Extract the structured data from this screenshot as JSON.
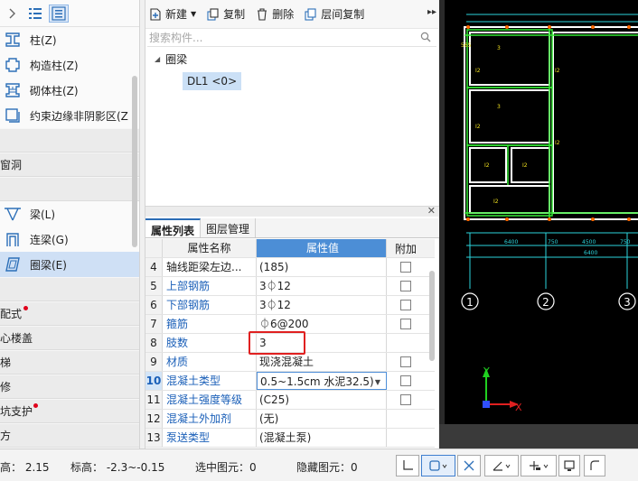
{
  "left_panel": {
    "items_top": [
      {
        "label": "柱(Z)",
        "icon": "column-icon"
      },
      {
        "label": "构造柱(Z)",
        "icon": "constructional-column-icon"
      },
      {
        "label": "砌体柱(Z)",
        "icon": "masonry-column-icon"
      },
      {
        "label": "约束边缘非阴影区(Z",
        "icon": "boundary-zone-icon"
      }
    ],
    "cat_1": "",
    "cat_2": "窗洞",
    "cat_3": "",
    "items_beam": [
      {
        "label": "梁(L)",
        "icon": "beam-icon"
      },
      {
        "label": "连梁(G)",
        "icon": "coupling-beam-icon"
      },
      {
        "label": "圈梁(E)",
        "icon": "ring-beam-icon"
      }
    ],
    "cat_4": "",
    "cat_5": "配式",
    "cat_6": "心楼盖",
    "cat_7": "梯",
    "cat_8": "修",
    "cat_9": "坑支护",
    "cat_10": "方"
  },
  "toolbar": {
    "new_label": "新建",
    "copy_label": "复制",
    "delete_label": "删除",
    "floor_copy_label": "层间复制"
  },
  "search": {
    "placeholder": "搜索构件..."
  },
  "tree": {
    "group_label": "圈梁",
    "leaf_label": "DL1 <0>"
  },
  "tabs": {
    "properties": "属性列表",
    "layers": "图层管理"
  },
  "table": {
    "header": {
      "name": "属性名称",
      "value": "属性值",
      "add": "附加"
    },
    "rows": [
      {
        "num": "4",
        "name": "轴线距梁左边...",
        "value": "(185)",
        "checkbox": true,
        "blue": false
      },
      {
        "num": "5",
        "name": "上部钢筋",
        "value": "3⏀12",
        "checkbox": true,
        "blue": true
      },
      {
        "num": "6",
        "name": "下部钢筋",
        "value": "3⏀12",
        "checkbox": true,
        "blue": true
      },
      {
        "num": "7",
        "name": "箍筋",
        "value": "⏀6@200",
        "checkbox": true,
        "blue": true
      },
      {
        "num": "8",
        "name": "肢数",
        "value": "3",
        "checkbox": false,
        "blue": true
      },
      {
        "num": "9",
        "name": "材质",
        "value": "现浇混凝土",
        "checkbox": true,
        "blue": true
      },
      {
        "num": "10",
        "name": "混凝土类型",
        "value": "0.5~1.5cm 水泥32.5)",
        "checkbox": true,
        "blue": true
      },
      {
        "num": "11",
        "name": "混凝土强度等级",
        "value": "(C25)",
        "checkbox": true,
        "blue": true
      },
      {
        "num": "12",
        "name": "混凝土外加剂",
        "value": "(无)",
        "checkbox": false,
        "blue": true
      },
      {
        "num": "13",
        "name": "泵送类型",
        "value": "(混凝土泵)",
        "checkbox": false,
        "blue": true
      }
    ]
  },
  "cad": {
    "axis_labels": [
      "1",
      "2",
      "3"
    ],
    "dim_labels": [
      "6400",
      "750",
      "4500",
      "750",
      "6400"
    ],
    "axis_x": "X",
    "axis_y": "Y",
    "colors": {
      "wall": "#ffffff",
      "rebar": "#35e835",
      "dims": "#2cd4dc",
      "tag": "#f0e020",
      "axis_x": "#e02020",
      "axis_y": "#20d020"
    }
  },
  "status": {
    "height": "高： 2.15",
    "elevation": "标高： -2.3~-0.15",
    "selected": "选中图元：0",
    "hidden": "隐藏图元：0"
  }
}
